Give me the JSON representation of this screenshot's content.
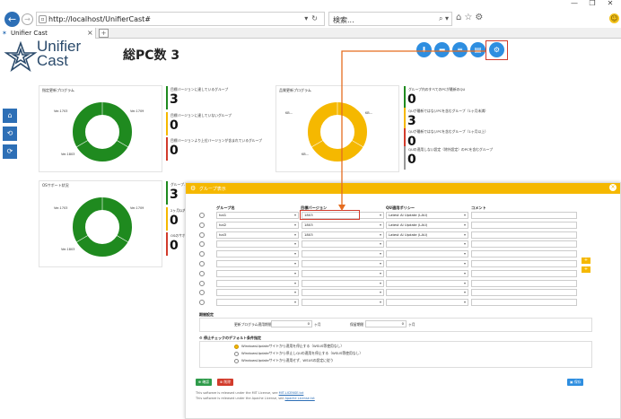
{
  "browser": {
    "url": "http://localhost/UnifierCast#",
    "search_placeholder": "検索...",
    "tab_label": "Unifier Cast",
    "win_controls": [
      "—",
      "❐",
      "✕"
    ]
  },
  "header": {
    "logo_line1": "Unifier",
    "logo_line2": "Cast",
    "page_title": "総PC数 3"
  },
  "cards": [
    {
      "title": "指定更新プログラム",
      "labels": [
        "Ver.1703",
        "Ver.1709",
        "Ver.1803"
      ],
      "donut_color": "#1f8a1f",
      "stats": [
        {
          "label": "目標バージョンに達しているグループ",
          "value": "3",
          "color": "#1f8a1f"
        },
        {
          "label": "目標バージョンに達していないグループ",
          "value": "0",
          "color": "#f5b800"
        },
        {
          "label": "目標バージョンより上位バージョンが含まれているグループ",
          "value": "0",
          "color": "#d23b2b"
        }
      ]
    },
    {
      "title": "品質更新プログラム",
      "labels": [
        "KB…",
        "KB…",
        "KB…"
      ],
      "donut_color": "#f5b800",
      "stats": [
        {
          "label": "グループ内のすべてのPCが最新のQU",
          "value": "0",
          "color": "#1f8a1f"
        },
        {
          "label": "QUが最新ではないPCを含むグループ（1ヶ月未満）",
          "value": "3",
          "color": "#f5b800"
        },
        {
          "label": "QUが最新ではないPCを含むグループ（1ヶ月以上）",
          "value": "0",
          "color": "#d23b2b"
        },
        {
          "label": "QUの適用しない設定（除外設定）のPCを含むグループ",
          "value": "0",
          "color": "#999999"
        }
      ]
    },
    {
      "title": "OSサポート状況",
      "labels": [
        "Ver.1703",
        "Ver.1709",
        "Ver.1803"
      ],
      "donut_color": "#1f8a1f",
      "stats": [
        {
          "label": "グループ…",
          "value": "3",
          "color": "#1f8a1f"
        },
        {
          "label": "2ヶ月以内…",
          "value": "0",
          "color": "#f5b800"
        },
        {
          "label": "OSのサポ…",
          "value": "0",
          "color": "#d23b2b"
        }
      ]
    }
  ],
  "modal": {
    "title": "グループ表示",
    "columns": {
      "group": "グループ名",
      "target_version": "目標バージョン",
      "qu_policy": "QU適用ポリシー",
      "comment": "コメント"
    },
    "rows": [
      {
        "group": "hal1",
        "version": "1803",
        "policy": "Latest AI Update (LAU)"
      },
      {
        "group": "hal2",
        "version": "1803",
        "policy": "Latest AI Update (LAU)"
      },
      {
        "group": "hal3",
        "version": "1803",
        "policy": "Latest AI Update (LAU)"
      },
      {
        "group": "",
        "version": "",
        "policy": ""
      },
      {
        "group": "",
        "version": "",
        "policy": ""
      },
      {
        "group": "",
        "version": "",
        "policy": ""
      },
      {
        "group": "",
        "version": "",
        "policy": ""
      },
      {
        "group": "",
        "version": "",
        "policy": ""
      },
      {
        "group": "",
        "version": "",
        "policy": ""
      },
      {
        "group": "",
        "version": "",
        "policy": ""
      }
    ],
    "settings": {
      "title": "期間設定",
      "field1_label": "更新プログラム適用期間",
      "field1_value": "0",
      "field1_unit": "ヶ月",
      "field2_label": "保留期間",
      "field2_value": "0",
      "field2_unit": "ヶ月"
    },
    "defaults": {
      "title": "停止チェックのデフォルト条件指定",
      "options": [
        "WindowsUpdateサイトから適用を停止する（WSUS等使用なし）",
        "WindowsUpdateサイトから停止しQUの適用を停止する（WSUS等使用なし）",
        "WindowsUpdateサイトから適用せず、WSUSの設定に従う"
      ]
    },
    "buttons": {
      "confirm": "確認",
      "delete": "削除",
      "save": "保存"
    },
    "footnotes": [
      {
        "text": "This software is released under the MIT License, see ",
        "link": "MIT-LICENSE.txt"
      },
      {
        "text": "This software is released under the Apache License, see ",
        "link": "Apache License.txt"
      }
    ]
  }
}
